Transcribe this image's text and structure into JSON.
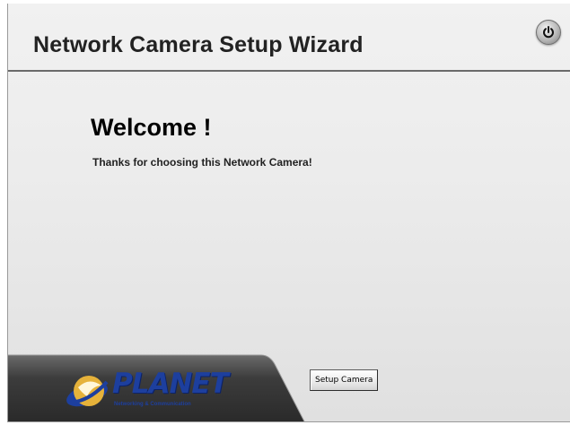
{
  "header": {
    "title": "Network Camera Setup Wizard",
    "power_icon": "power-icon"
  },
  "welcome": {
    "title": "Welcome !",
    "message": "Thanks for choosing this Network Camera!"
  },
  "footer": {
    "logo_text": "PLANET",
    "logo_tagline": "Networking & Communication",
    "setup_button_label": "Setup Camera"
  },
  "colors": {
    "logo_blue": "#1d3f9e",
    "logo_gold": "#e6b23a",
    "footer_dark": "#3a3a3a"
  }
}
